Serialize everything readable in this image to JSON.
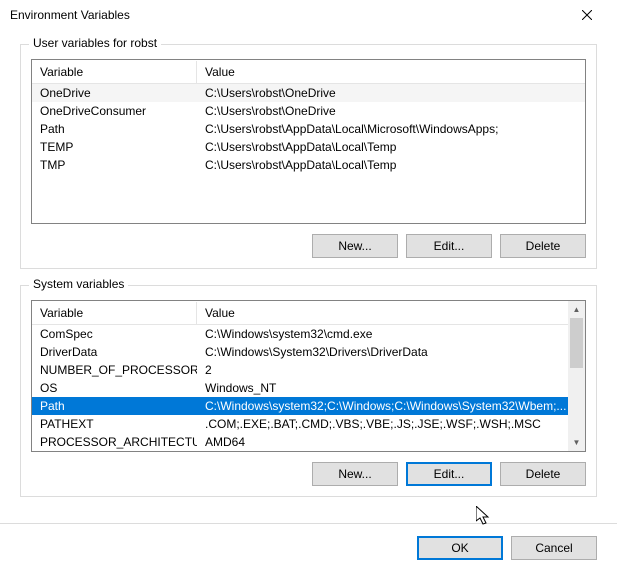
{
  "title": "Environment Variables",
  "user_group": {
    "label": "User variables for robst",
    "columns": [
      "Variable",
      "Value"
    ],
    "rows": [
      {
        "variable": "OneDrive",
        "value": "C:\\Users\\robst\\OneDrive"
      },
      {
        "variable": "OneDriveConsumer",
        "value": "C:\\Users\\robst\\OneDrive"
      },
      {
        "variable": "Path",
        "value": "C:\\Users\\robst\\AppData\\Local\\Microsoft\\WindowsApps;"
      },
      {
        "variable": "TEMP",
        "value": "C:\\Users\\robst\\AppData\\Local\\Temp"
      },
      {
        "variable": "TMP",
        "value": "C:\\Users\\robst\\AppData\\Local\\Temp"
      }
    ],
    "buttons": {
      "new": "New...",
      "edit": "Edit...",
      "delete": "Delete"
    }
  },
  "sys_group": {
    "label": "System variables",
    "columns": [
      "Variable",
      "Value"
    ],
    "rows": [
      {
        "variable": "ComSpec",
        "value": "C:\\Windows\\system32\\cmd.exe"
      },
      {
        "variable": "DriverData",
        "value": "C:\\Windows\\System32\\Drivers\\DriverData"
      },
      {
        "variable": "NUMBER_OF_PROCESSORS",
        "value": "2"
      },
      {
        "variable": "OS",
        "value": "Windows_NT"
      },
      {
        "variable": "Path",
        "value": "C:\\Windows\\system32;C:\\Windows;C:\\Windows\\System32\\Wbem;..."
      },
      {
        "variable": "PATHEXT",
        "value": ".COM;.EXE;.BAT;.CMD;.VBS;.VBE;.JS;.JSE;.WSF;.WSH;.MSC"
      },
      {
        "variable": "PROCESSOR_ARCHITECTURE",
        "value": "AMD64"
      }
    ],
    "selected_index": 4,
    "buttons": {
      "new": "New...",
      "edit": "Edit...",
      "delete": "Delete"
    }
  },
  "footer": {
    "ok": "OK",
    "cancel": "Cancel"
  }
}
